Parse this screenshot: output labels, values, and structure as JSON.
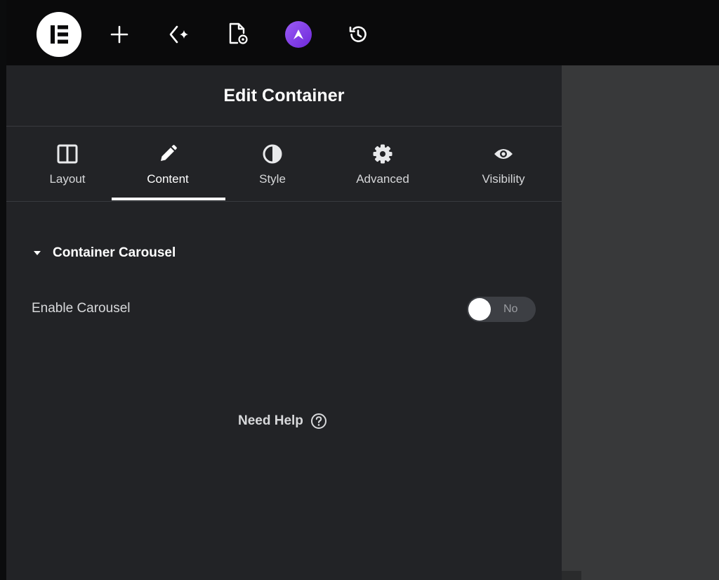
{
  "colors": {
    "topbar_bg": "#0a0a0b",
    "panel_bg": "#222326",
    "canvas_bg": "#38393a",
    "ai_accent": "#7c3aed"
  },
  "topbar": {
    "icons": [
      "elementor-logo-icon",
      "plus-icon",
      "sparkle-icon",
      "page-settings-icon",
      "ai-badge-icon",
      "history-icon"
    ]
  },
  "panel": {
    "title": "Edit Container",
    "tabs": [
      {
        "label": "Layout",
        "icon": "layout-columns-icon"
      },
      {
        "label": "Content",
        "icon": "pencil-icon",
        "active": true
      },
      {
        "label": "Style",
        "icon": "half-circle-icon"
      },
      {
        "label": "Advanced",
        "icon": "gear-icon"
      },
      {
        "label": "Visibility",
        "icon": "eye-icon"
      }
    ],
    "section": {
      "title": "Container Carousel",
      "fields": [
        {
          "label": "Enable Carousel",
          "toggle_value": "No"
        }
      ]
    },
    "help_label": "Need Help"
  }
}
